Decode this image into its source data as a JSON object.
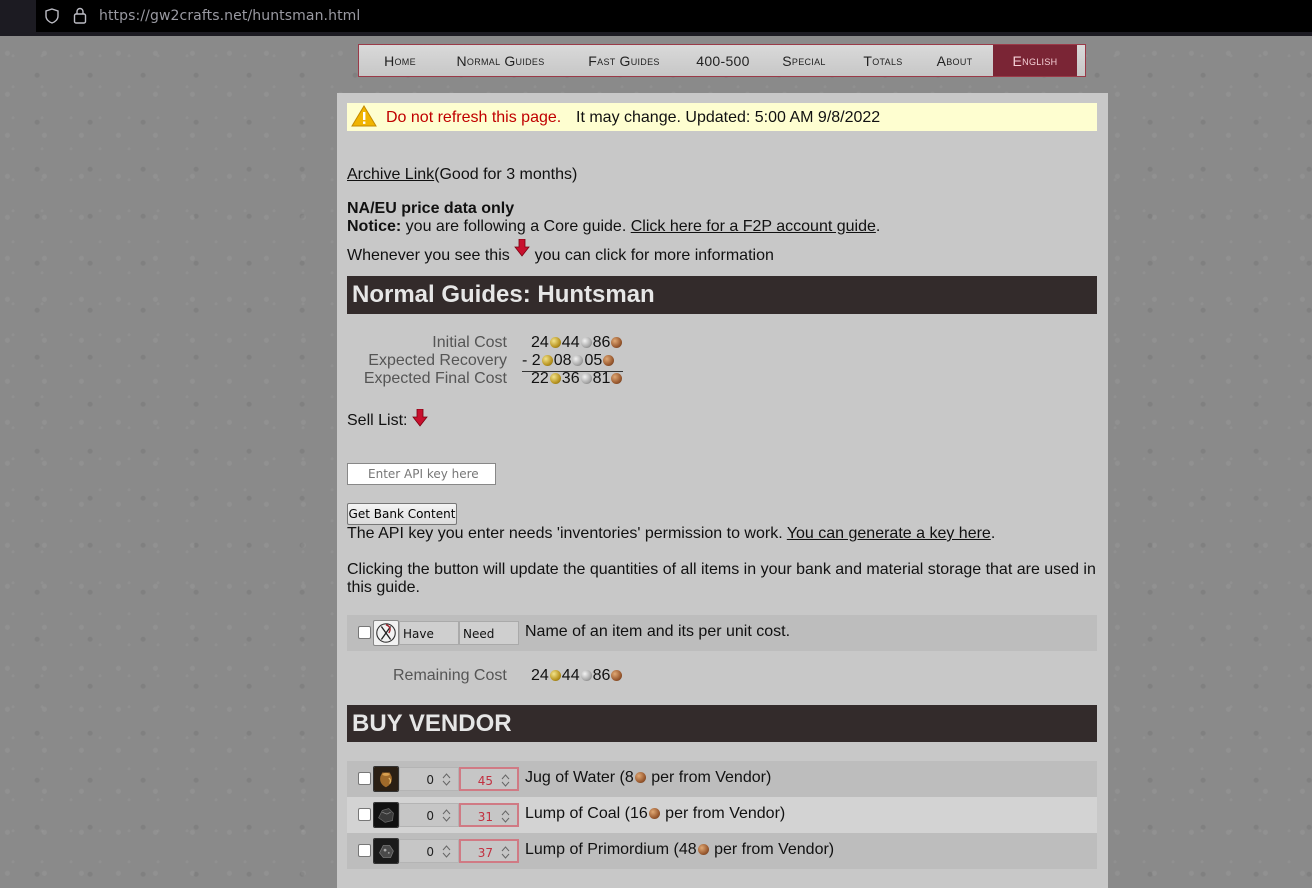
{
  "browser": {
    "url": "https://gw2crafts.net/huntsman.html"
  },
  "nav": {
    "items": [
      {
        "first": "H",
        "rest": "ome"
      },
      {
        "first": "N",
        "rest": "ormal ",
        "first2": "G",
        "rest2": "uides"
      },
      {
        "first": "F",
        "rest": "ast ",
        "first2": "G",
        "rest2": "uides"
      },
      {
        "first": "400-500",
        "rest": ""
      },
      {
        "first": "S",
        "rest": "pecial"
      },
      {
        "first": "T",
        "rest": "otals"
      },
      {
        "first": "A",
        "rest": "bout"
      },
      {
        "first": "E",
        "rest": "nglish"
      }
    ]
  },
  "warning": {
    "red": "Do not refresh this page.",
    "rest": "It may change. Updated: 5:00 AM 9/8/2022"
  },
  "archive": {
    "link": "Archive Link",
    "note": "(Good for 3 months)"
  },
  "notices": {
    "price_data": "NA/EU price data only",
    "notice_label": "Notice:",
    "notice_text": " you are following a Core guide. ",
    "f2p_link": "Click here for a F2P account guide",
    "f2p_end": ".",
    "whenever_a": "Whenever you see this",
    "whenever_b": "you can click for more information"
  },
  "guide": {
    "title": "Normal Guides: Huntsman"
  },
  "costs": {
    "initial_label": "Initial Cost",
    "initial": {
      "gold": "24",
      "silver": "44",
      "copper": "86"
    },
    "recovery_label": "Expected Recovery",
    "recovery_prefix": "- ",
    "recovery": {
      "gold": "2",
      "silver": "08",
      "copper": "05"
    },
    "final_label": "Expected Final Cost",
    "final": {
      "gold": "22",
      "silver": "36",
      "copper": "81"
    }
  },
  "sell_list": "Sell List:",
  "api": {
    "placeholder": "Enter API key here",
    "button": "Get Bank Content",
    "perm_text": "The API key you enter needs 'inventories' permission to work. ",
    "perm_link": "You can generate a key here",
    "perm_end": ".",
    "clicking_text": "Clicking the button will update the quantities of all items in your bank and material storage that are used in",
    "clicking_text2": "this guide."
  },
  "legend": {
    "have": "Have",
    "need": "Need",
    "description": "Name of an item and its per unit cost."
  },
  "remaining": {
    "label": "Remaining Cost",
    "value": {
      "gold": "24",
      "silver": "44",
      "copper": "86"
    }
  },
  "buy_vendor": {
    "title": "BUY VENDOR",
    "items": [
      {
        "have": "0",
        "need": "45",
        "name_a": "Jug of Water (8",
        "name_b": " per from Vendor)",
        "icon": "jug-of-water-icon"
      },
      {
        "have": "0",
        "need": "31",
        "name_a": "Lump of Coal (16",
        "name_b": " per from Vendor)",
        "icon": "lump-of-coal-icon"
      },
      {
        "have": "0",
        "need": "37",
        "name_a": "Lump of Primordium (48",
        "name_b": " per from Vendor)",
        "icon": "lump-of-primordium-icon"
      }
    ]
  },
  "colors": {
    "header_bg": "#332b2b",
    "warning_red": "#c00000",
    "lang_bg": "#7a2535"
  }
}
